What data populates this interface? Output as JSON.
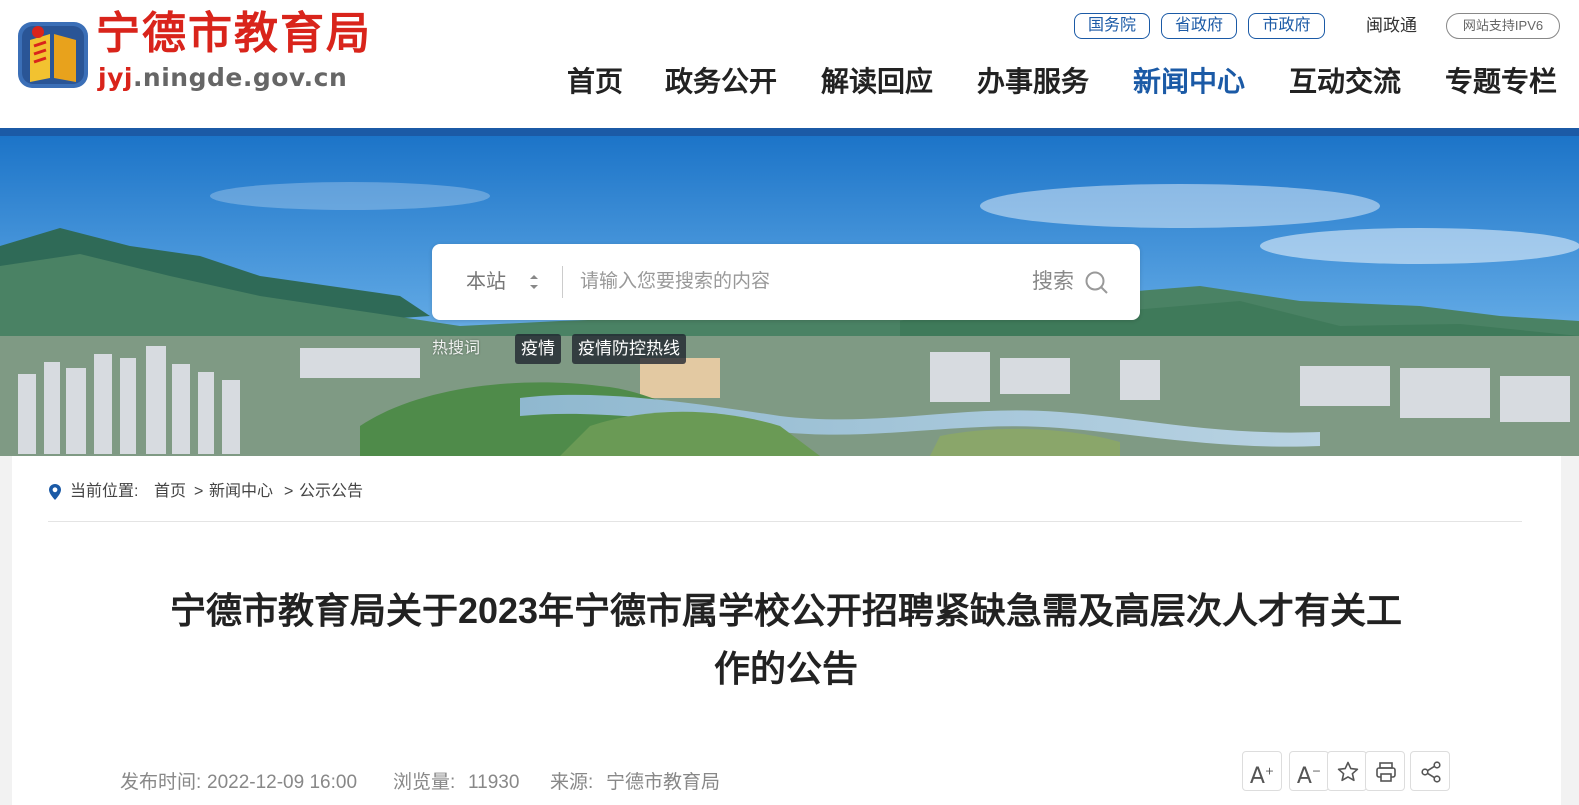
{
  "header": {
    "logo_cn": "宁德市教育局",
    "logo_en_prefix": "jyj",
    "logo_en_rest": ".ningde.gov.cn",
    "top_links": [
      "国务院",
      "省政府",
      "市政府"
    ],
    "minzhengtong": "闽政通",
    "ipv6_badge": "网站支持IPV6",
    "nav": [
      "首页",
      "政务公开",
      "解读回应",
      "办事服务",
      "新闻中心",
      "互动交流",
      "专题专栏"
    ],
    "active_nav": "新闻中心",
    "accent_color": "#1b5aa6",
    "brand_red": "#d9241b"
  },
  "search": {
    "scope": "本站",
    "placeholder": "请输入您要搜索的内容",
    "button_label": "搜索",
    "hot_label": "热搜词",
    "hot_words": [
      "疫情",
      "疫情防控热线"
    ]
  },
  "breadcrumb": {
    "label": "当前位置:",
    "items": [
      "首页",
      "新闻中心",
      "公示公告"
    ],
    "separator": ">"
  },
  "article": {
    "title_line1": "宁德市教育局关于2023年宁德市属学校公开招聘紧缺急需及高层次人才有关工",
    "title_line2": "作的公告",
    "publish_label": "发布时间:",
    "publish_time": "2022-12-09 16:00",
    "views_label": "浏览量:",
    "views": "11930",
    "source_label": "来源:",
    "source": "宁德市教育局"
  },
  "tools": {
    "font_increase": "A",
    "font_decrease": "A",
    "icons": [
      "font-increase-icon",
      "font-decrease-icon",
      "star-icon",
      "print-icon",
      "share-icon"
    ]
  }
}
